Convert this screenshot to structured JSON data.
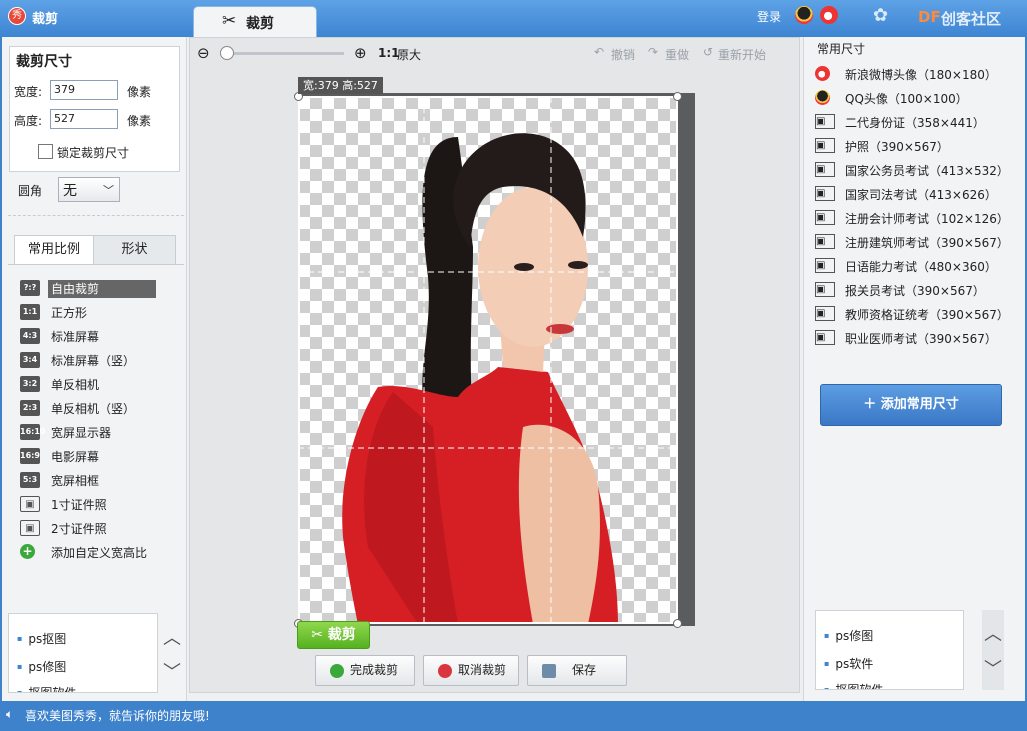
{
  "app": {
    "title": "裁剪",
    "logo": "秀"
  },
  "titlebar": {
    "tab_label": "裁剪",
    "login": "登录",
    "brand_df": "DF",
    "brand_text": "创客社区"
  },
  "left": {
    "size_title": "裁剪尺寸",
    "width_label": "宽度:",
    "width_value": "379",
    "width_unit": "像素",
    "height_label": "高度:",
    "height_value": "527",
    "height_unit": "像素",
    "lock_label": "锁定裁剪尺寸",
    "corner_label": "圆角",
    "corner_value": "无",
    "tabs": [
      "常用比例",
      "形状"
    ],
    "ratios": [
      {
        "icon": "?:?",
        "label": "自由裁剪"
      },
      {
        "icon": "1:1",
        "label": "正方形"
      },
      {
        "icon": "4:3",
        "label": "标准屏幕"
      },
      {
        "icon": "3:4",
        "label": "标准屏幕（竖）"
      },
      {
        "icon": "3:2",
        "label": "单反相机"
      },
      {
        "icon": "2:3",
        "label": "单反相机（竖）"
      },
      {
        "icon": "16:10",
        "label": "宽屏显示器"
      },
      {
        "icon": "16:9",
        "label": "电影屏幕"
      },
      {
        "icon": "5:3",
        "label": "宽屏相框"
      },
      {
        "icon": "id-card",
        "label": "1寸证件照"
      },
      {
        "icon": "id-card",
        "label": "2寸证件照"
      },
      {
        "icon": "plus",
        "label": "添加自定义宽高比"
      }
    ],
    "links": [
      "ps抠图",
      "ps修图",
      "抠图软件"
    ]
  },
  "toolbar": {
    "zoom_ratio": "1:1",
    "original_size": "原大",
    "undo": "撤销",
    "redo": "重做",
    "restart": "重新开始"
  },
  "canvas": {
    "size_readout": "宽:379 高:527",
    "crop_button": "裁剪"
  },
  "actions": {
    "done": "完成裁剪",
    "cancel": "取消裁剪",
    "save": "保存"
  },
  "right": {
    "title": "常用尺寸",
    "presets": [
      {
        "icon": "weibo-icon",
        "label": "新浪微博头像（180×180）"
      },
      {
        "icon": "qq-icon",
        "label": "QQ头像（100×100）"
      },
      {
        "icon": "id-card",
        "label": "二代身份证（358×441）"
      },
      {
        "icon": "id-card",
        "label": "护照（390×567）"
      },
      {
        "icon": "id-card",
        "label": "国家公务员考试（413×532）"
      },
      {
        "icon": "id-card",
        "label": "国家司法考试（413×626）"
      },
      {
        "icon": "id-card",
        "label": "注册会计师考试（102×126）"
      },
      {
        "icon": "id-card",
        "label": "注册建筑师考试（390×567）"
      },
      {
        "icon": "id-card",
        "label": "日语能力考试（480×360）"
      },
      {
        "icon": "id-card",
        "label": "报关员考试（390×567）"
      },
      {
        "icon": "id-card",
        "label": "教师资格证统考（390×567）"
      },
      {
        "icon": "id-card",
        "label": "职业医师考试（390×567）"
      }
    ],
    "add_button": "添加常用尺寸",
    "links": [
      "ps修图",
      "ps软件",
      "抠图软件"
    ]
  },
  "status": {
    "text": "喜欢美图秀秀，就告诉你的朋友哦!"
  }
}
